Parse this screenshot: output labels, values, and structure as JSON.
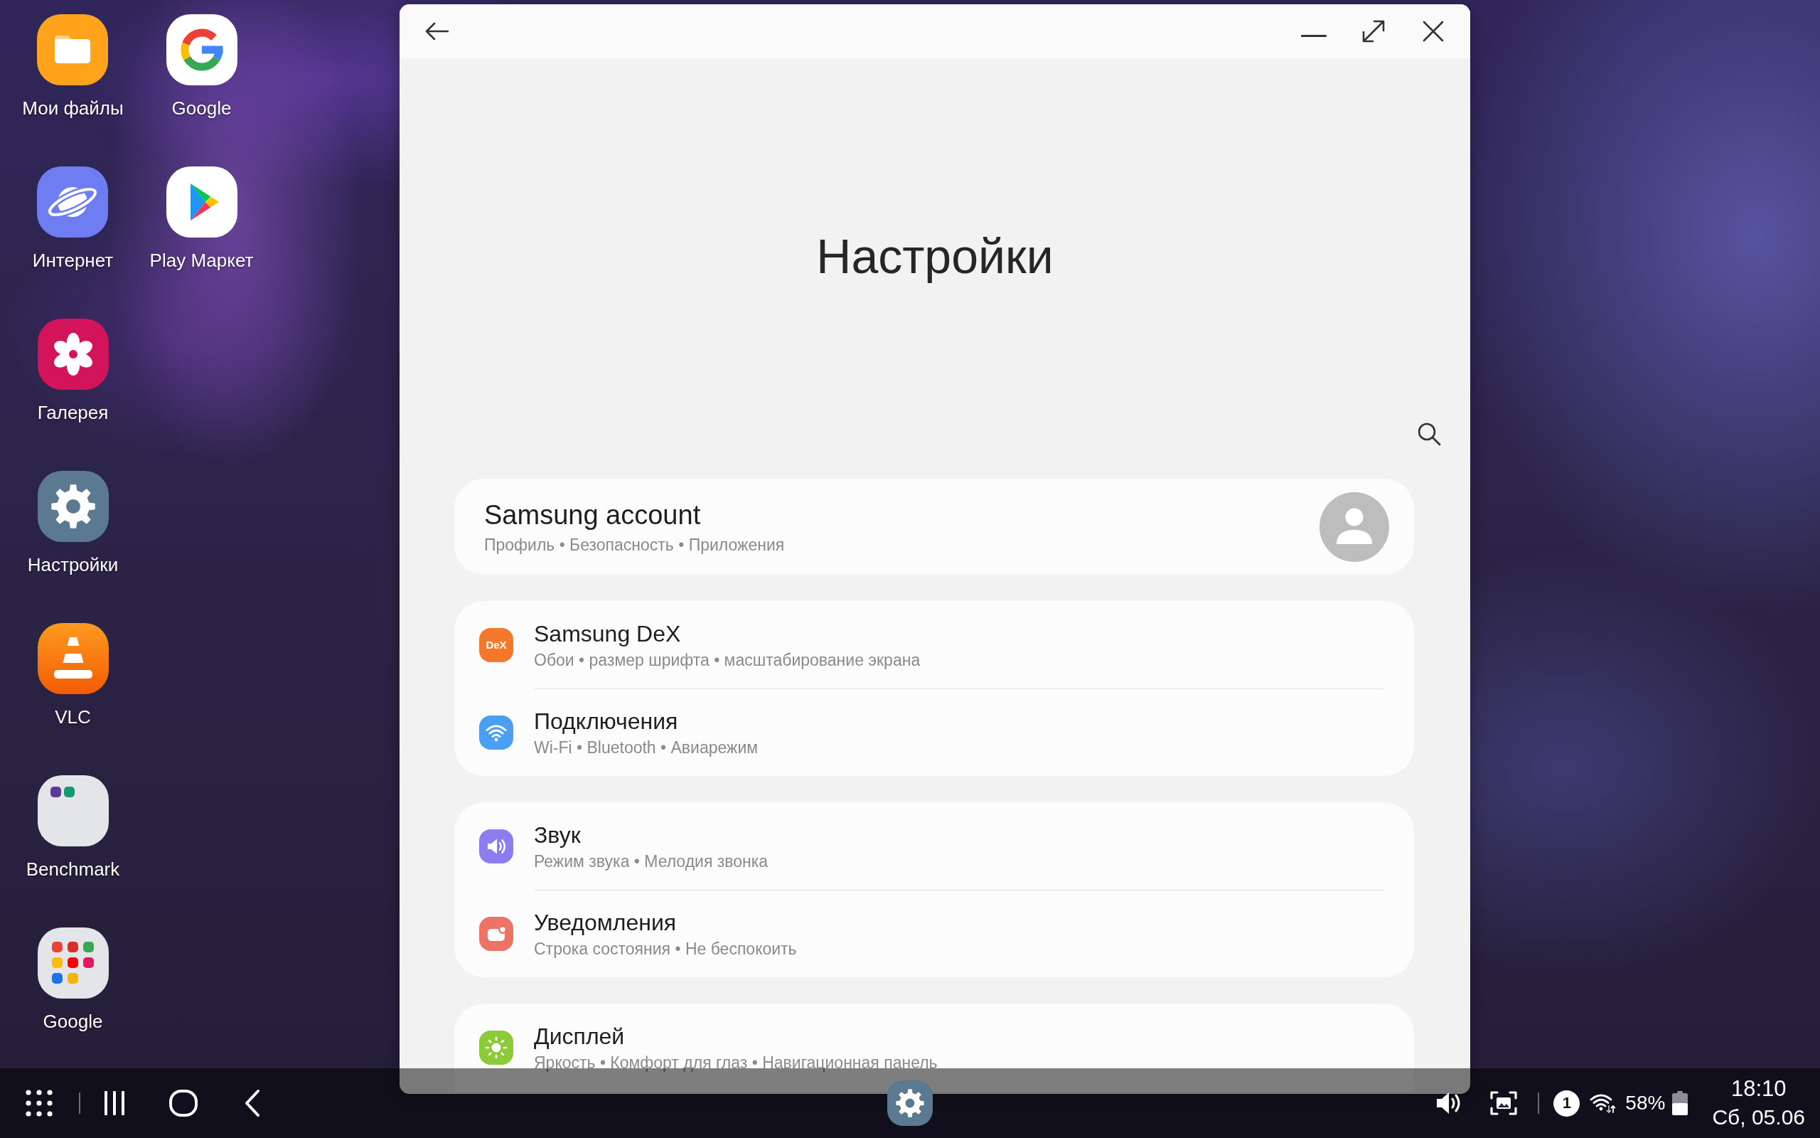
{
  "desktop": {
    "shortcuts": [
      {
        "kind": "files",
        "label": "Мои файлы"
      },
      {
        "kind": "browser",
        "label": "Интернет"
      },
      {
        "kind": "gallery",
        "label": "Галерея"
      },
      {
        "kind": "settings",
        "label": "Настройки"
      },
      {
        "kind": "player",
        "label": "VLC"
      },
      {
        "kind": "folder",
        "label": "Benchmark"
      },
      {
        "kind": "appfolder",
        "label": "Google"
      },
      {
        "kind": "google",
        "label": "Google"
      },
      {
        "kind": "store",
        "label": "Play Маркет"
      }
    ]
  },
  "window": {
    "heading": "Настройки",
    "account": {
      "title": "Samsung account",
      "subtitle": "Профиль • Безопасность • Приложения"
    },
    "groups": [
      {
        "items": [
          {
            "kind": "dex",
            "icon_text": "DeX",
            "color": "#f5782a",
            "title": "Samsung DeX",
            "subtitle": "Обои • размер шрифта • масштабирование экрана"
          },
          {
            "kind": "wifi",
            "color": "#4b9ff2",
            "title": "Подключения",
            "subtitle": "Wi-Fi • Bluetooth • Авиарежим"
          }
        ]
      },
      {
        "items": [
          {
            "kind": "sound",
            "color": "#8b7cef",
            "title": "Звук",
            "subtitle": "Режим звука • Мелодия звонка"
          },
          {
            "kind": "notifications",
            "color": "#ee7367",
            "title": "Уведомления",
            "subtitle": "Строка состояния • Не беспокоить"
          }
        ]
      },
      {
        "items": [
          {
            "kind": "display",
            "color": "#8bcb38",
            "title": "Дисплей",
            "subtitle": "Яркость • Комфорт для глаз • Навигационная панель"
          }
        ]
      }
    ]
  },
  "taskbar": {
    "notification_count": "1",
    "battery": "58%",
    "time": "18:10",
    "date": "Сб, 05.06"
  }
}
